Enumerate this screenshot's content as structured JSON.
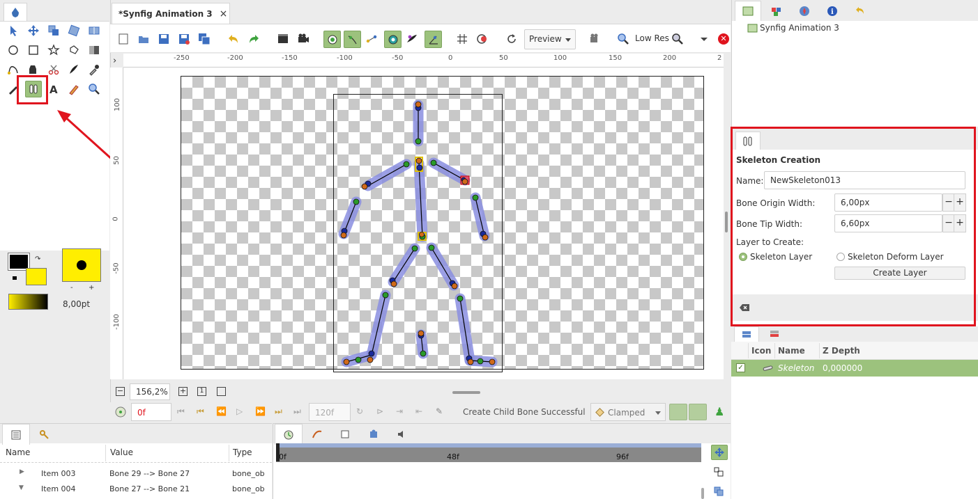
{
  "document_tab": {
    "title": "*Synfig Animation 3",
    "close": "×"
  },
  "toolbar": {
    "preview_label": "Preview",
    "render_quality": "Low Res"
  },
  "ruler": {
    "h": [
      "-250",
      "-200",
      "-150",
      "-100",
      "-50",
      "0",
      "50",
      "100",
      "150",
      "200",
      "2"
    ],
    "v": [
      "100",
      "50",
      "0",
      "-50",
      "-100"
    ]
  },
  "canvas_status": {
    "zoom": "156,2%"
  },
  "timebar": {
    "current_frame": "0f",
    "end_frame": "120f",
    "status_message": "Create Child Bone Successful",
    "interpolation": "Clamped"
  },
  "colors": {
    "outline": "#000000",
    "fill": "#ffee00",
    "accent_green": "#9cc27d"
  },
  "brush": {
    "size": "8,00pt",
    "minus": "-",
    "plus": "+"
  },
  "canvas_browser": {
    "item": "Synfig Animation 3"
  },
  "tool_options": {
    "title": "Skeleton Creation",
    "name_label": "Name:",
    "name_value": "NewSkeleton013",
    "origin_label": "Bone Origin Width:",
    "origin_value": "6,00px",
    "tip_label": "Bone Tip Width:",
    "tip_value": "6,60px",
    "layer_label": "Layer to Create:",
    "radio_skeleton": "Skeleton Layer",
    "radio_deform": "Skeleton Deform Layer",
    "create_button": "Create Layer",
    "minus": "−",
    "plus": "+"
  },
  "layers": {
    "headers": {
      "icon": "Icon",
      "name": "Name",
      "zdepth": "Z Depth"
    },
    "rows": [
      {
        "name": "Skeleton",
        "zdepth": "0,000000"
      }
    ]
  },
  "params": {
    "headers": {
      "name": "Name",
      "value": "Value",
      "type": "Type"
    },
    "rows": [
      {
        "name": "Item 003",
        "value": "Bone 29 --> Bone 27",
        "type": "bone_ob"
      },
      {
        "name": "Item 004",
        "value": "Bone 27 --> Bone 21",
        "type": "bone_ob"
      }
    ]
  },
  "timetrack": {
    "labels": [
      "0f",
      "48f",
      "96f"
    ]
  }
}
